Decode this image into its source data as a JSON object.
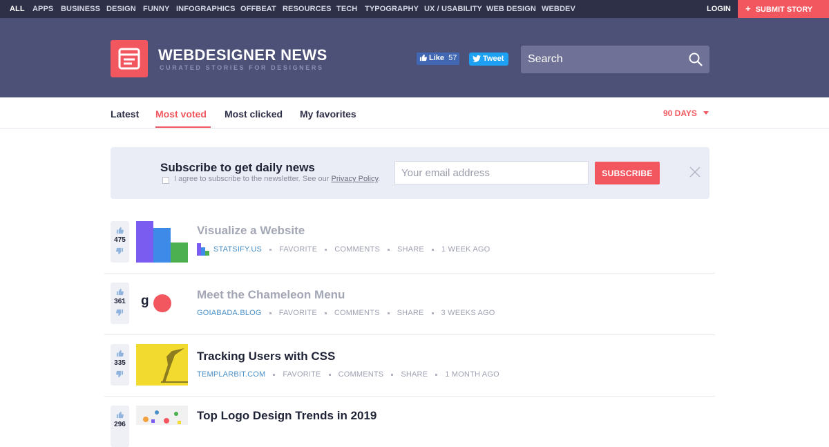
{
  "nav": {
    "categories": [
      "ALL",
      "APPS",
      "BUSINESS",
      "DESIGN",
      "FUNNY",
      "INFOGRAPHICS",
      "OFFBEAT",
      "RESOURCES",
      "TECH",
      "TYPOGRAPHY",
      "UX / USABILITY",
      "WEB DESIGN",
      "WEBDEV"
    ],
    "login": "LOGIN",
    "submit": "SUBMIT STORY"
  },
  "header": {
    "title": "WEBDESIGNER NEWS",
    "tagline": "CURATED STORIES FOR DESIGNERS",
    "like_label": "Like",
    "like_count": "57",
    "tweet_label": "Tweet",
    "search_placeholder": "Search"
  },
  "tabs": [
    "Latest",
    "Most voted",
    "Most clicked",
    "My favorites"
  ],
  "active_tab": "Most voted",
  "period": "90 DAYS",
  "subscribe": {
    "title": "Subscribe to get daily news",
    "agree": "I agree to subscribe to the newsletter. See our",
    "privacy": "Privacy Policy",
    "email_placeholder": "Your email address",
    "button": "SUBSCRIBE"
  },
  "stories": [
    {
      "votes": "475",
      "title": "Visualize a Website",
      "source": "STATSIFY.US",
      "favorite": "FAVORITE",
      "comments": "COMMENTS",
      "share": "SHARE",
      "time": "1 WEEK AGO"
    },
    {
      "votes": "361",
      "title": "Meet the Chameleon Menu",
      "source": "GOIABADA.BLOG",
      "favorite": "FAVORITE",
      "comments": "COMMENTS",
      "share": "SHARE",
      "time": "3 WEEKS AGO"
    },
    {
      "votes": "335",
      "title": "Tracking Users with CSS",
      "source": "TEMPLARBIT.COM",
      "favorite": "FAVORITE",
      "comments": "COMMENTS",
      "share": "SHARE",
      "time": "1 MONTH AGO"
    },
    {
      "votes": "296",
      "title": "Top Logo Design Trends in 2019",
      "source": "",
      "favorite": "",
      "comments": "",
      "share": "",
      "time": ""
    }
  ],
  "thumb2_letter": "g",
  "colors": {
    "accent": "#f2575f",
    "header": "#4e5177",
    "topbar": "#2e3048",
    "link": "#4a90c8"
  }
}
